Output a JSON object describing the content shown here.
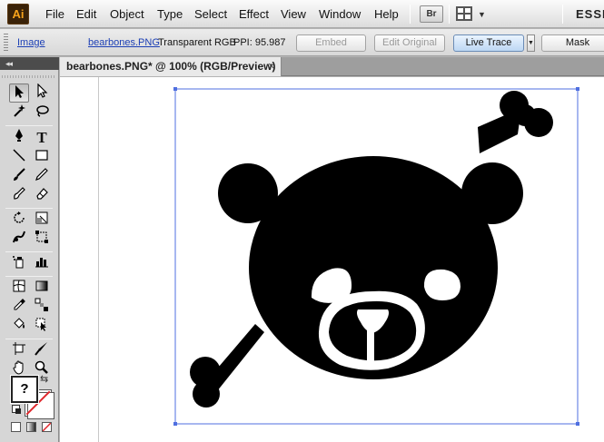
{
  "app": {
    "logo": "Ai"
  },
  "menu": {
    "items": [
      "File",
      "Edit",
      "Object",
      "Type",
      "Select",
      "Effect",
      "View",
      "Window",
      "Help"
    ],
    "bridge_label": "Br",
    "workspace": "ESSEN"
  },
  "control_bar": {
    "object_type": "Image",
    "file_name": "bearbones.PNG",
    "color_mode": "Transparent RGB",
    "ppi": "PPI: 95.987",
    "embed_label": "Embed",
    "edit_original_label": "Edit Original",
    "live_trace_label": "Live Trace",
    "mask_label": "Mask"
  },
  "tools": {
    "collapse_label": "◂◂",
    "fill_label": "?"
  },
  "document": {
    "tab_title": "bearbones.PNG* @ 100% (RGB/Preview)",
    "close_label": "×"
  },
  "colors": {
    "selection": "#4f6fe0",
    "artwork": "#000000",
    "none_slash": "#e0282d"
  }
}
